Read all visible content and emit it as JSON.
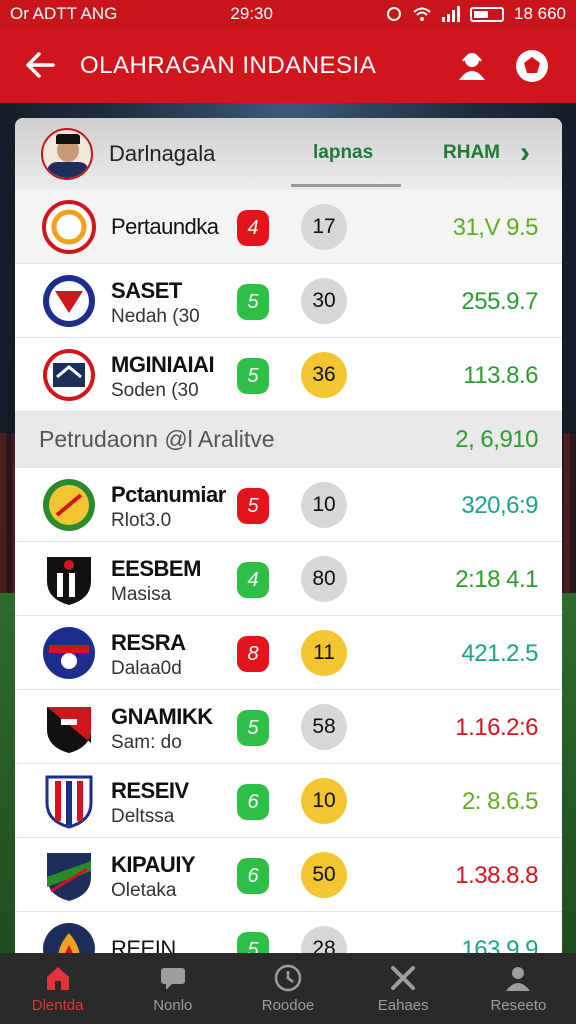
{
  "status_bar": {
    "left": "Or ADTT ANG",
    "time": "29:30",
    "right_text": "18 660"
  },
  "app_bar": {
    "back_glyph": "←",
    "title": "OLAHRAGAN INDANESIA"
  },
  "profile": {
    "name": "Darlnagala",
    "tabs": [
      "lapnas",
      "RHAM"
    ],
    "chevron": "›"
  },
  "rows_top": [
    {
      "team": "Pertaundka",
      "sub": "",
      "badge": "4",
      "badge_color": "red",
      "circle": "17",
      "circle_color": "grey",
      "value": "31,V 9.5",
      "value_color": "lime",
      "logo": "orange-ring-logo"
    },
    {
      "team": "SASET",
      "sub": "Nedah (30",
      "badge": "5",
      "badge_color": "green",
      "circle": "30",
      "circle_color": "grey",
      "value": "255.9.7",
      "value_color": "green",
      "logo": "red-v-shield-logo"
    },
    {
      "team": "MGINIAIAI",
      "sub": "Soden (30",
      "badge": "5",
      "badge_color": "green",
      "circle": "36",
      "circle_color": "yellow",
      "value": "113.8.6",
      "value_color": "green",
      "logo": "navy-crest-logo"
    }
  ],
  "section": {
    "label": "Petrudaonn @l Aralitve",
    "value": "2, 6,910"
  },
  "rows_bottom": [
    {
      "team": "Pctanumiar",
      "sub": "Rlot3.0",
      "badge": "5",
      "badge_color": "red",
      "circle": "10",
      "circle_color": "grey",
      "value": "320,6:9",
      "value_color": "teal",
      "logo": "green-yellow-badge-logo"
    },
    {
      "team": "EESBEM",
      "sub": "Masisa",
      "badge": "4",
      "badge_color": "green",
      "circle": "80",
      "circle_color": "grey",
      "value": "2:18 4.1",
      "value_color": "green",
      "logo": "black-striped-shield-logo"
    },
    {
      "team": "RESRA",
      "sub": "Dalaa0d",
      "badge": "8",
      "badge_color": "red",
      "circle": "11",
      "circle_color": "yellow",
      "value": "421.2.5",
      "value_color": "teal",
      "logo": "navy-blue-crest-logo"
    },
    {
      "team": "GNAMIKK",
      "sub": "Sam: do",
      "badge": "5",
      "badge_color": "green",
      "circle": "58",
      "circle_color": "grey",
      "value": "1.16.2:6",
      "value_color": "red",
      "logo": "red-black-shield-logo"
    },
    {
      "team": "RESEIV",
      "sub": "Deltssa",
      "badge": "6",
      "badge_color": "green",
      "circle": "10",
      "circle_color": "yellow",
      "value": "2: 8.6.5",
      "value_color": "lime",
      "logo": "red-blue-striped-shield-logo"
    },
    {
      "team": "KIPAUIY",
      "sub": "Oletaka",
      "badge": "6",
      "badge_color": "green",
      "circle": "50",
      "circle_color": "yellow",
      "value": "1.38.8.8",
      "value_color": "red",
      "logo": "green-navy-shield-logo"
    },
    {
      "team": "REEIN",
      "sub": "",
      "badge": "5",
      "badge_color": "green",
      "circle": "28",
      "circle_color": "grey",
      "value": "163.9.9",
      "value_color": "teal",
      "logo": "orange-flame-logo"
    }
  ],
  "bottom_nav": [
    {
      "label": "Dlentda",
      "icon": "home-icon",
      "active": true
    },
    {
      "label": "Nonlo",
      "icon": "chat-icon",
      "active": false
    },
    {
      "label": "Roodoe",
      "icon": "clock-icon",
      "active": false
    },
    {
      "label": "Eahaes",
      "icon": "tools-icon",
      "active": false
    },
    {
      "label": "Reseeto",
      "icon": "profile-icon",
      "active": false
    }
  ],
  "colors": {
    "primary_red": "#d0161c",
    "green": "#2ec046",
    "yellow": "#f2c531"
  }
}
